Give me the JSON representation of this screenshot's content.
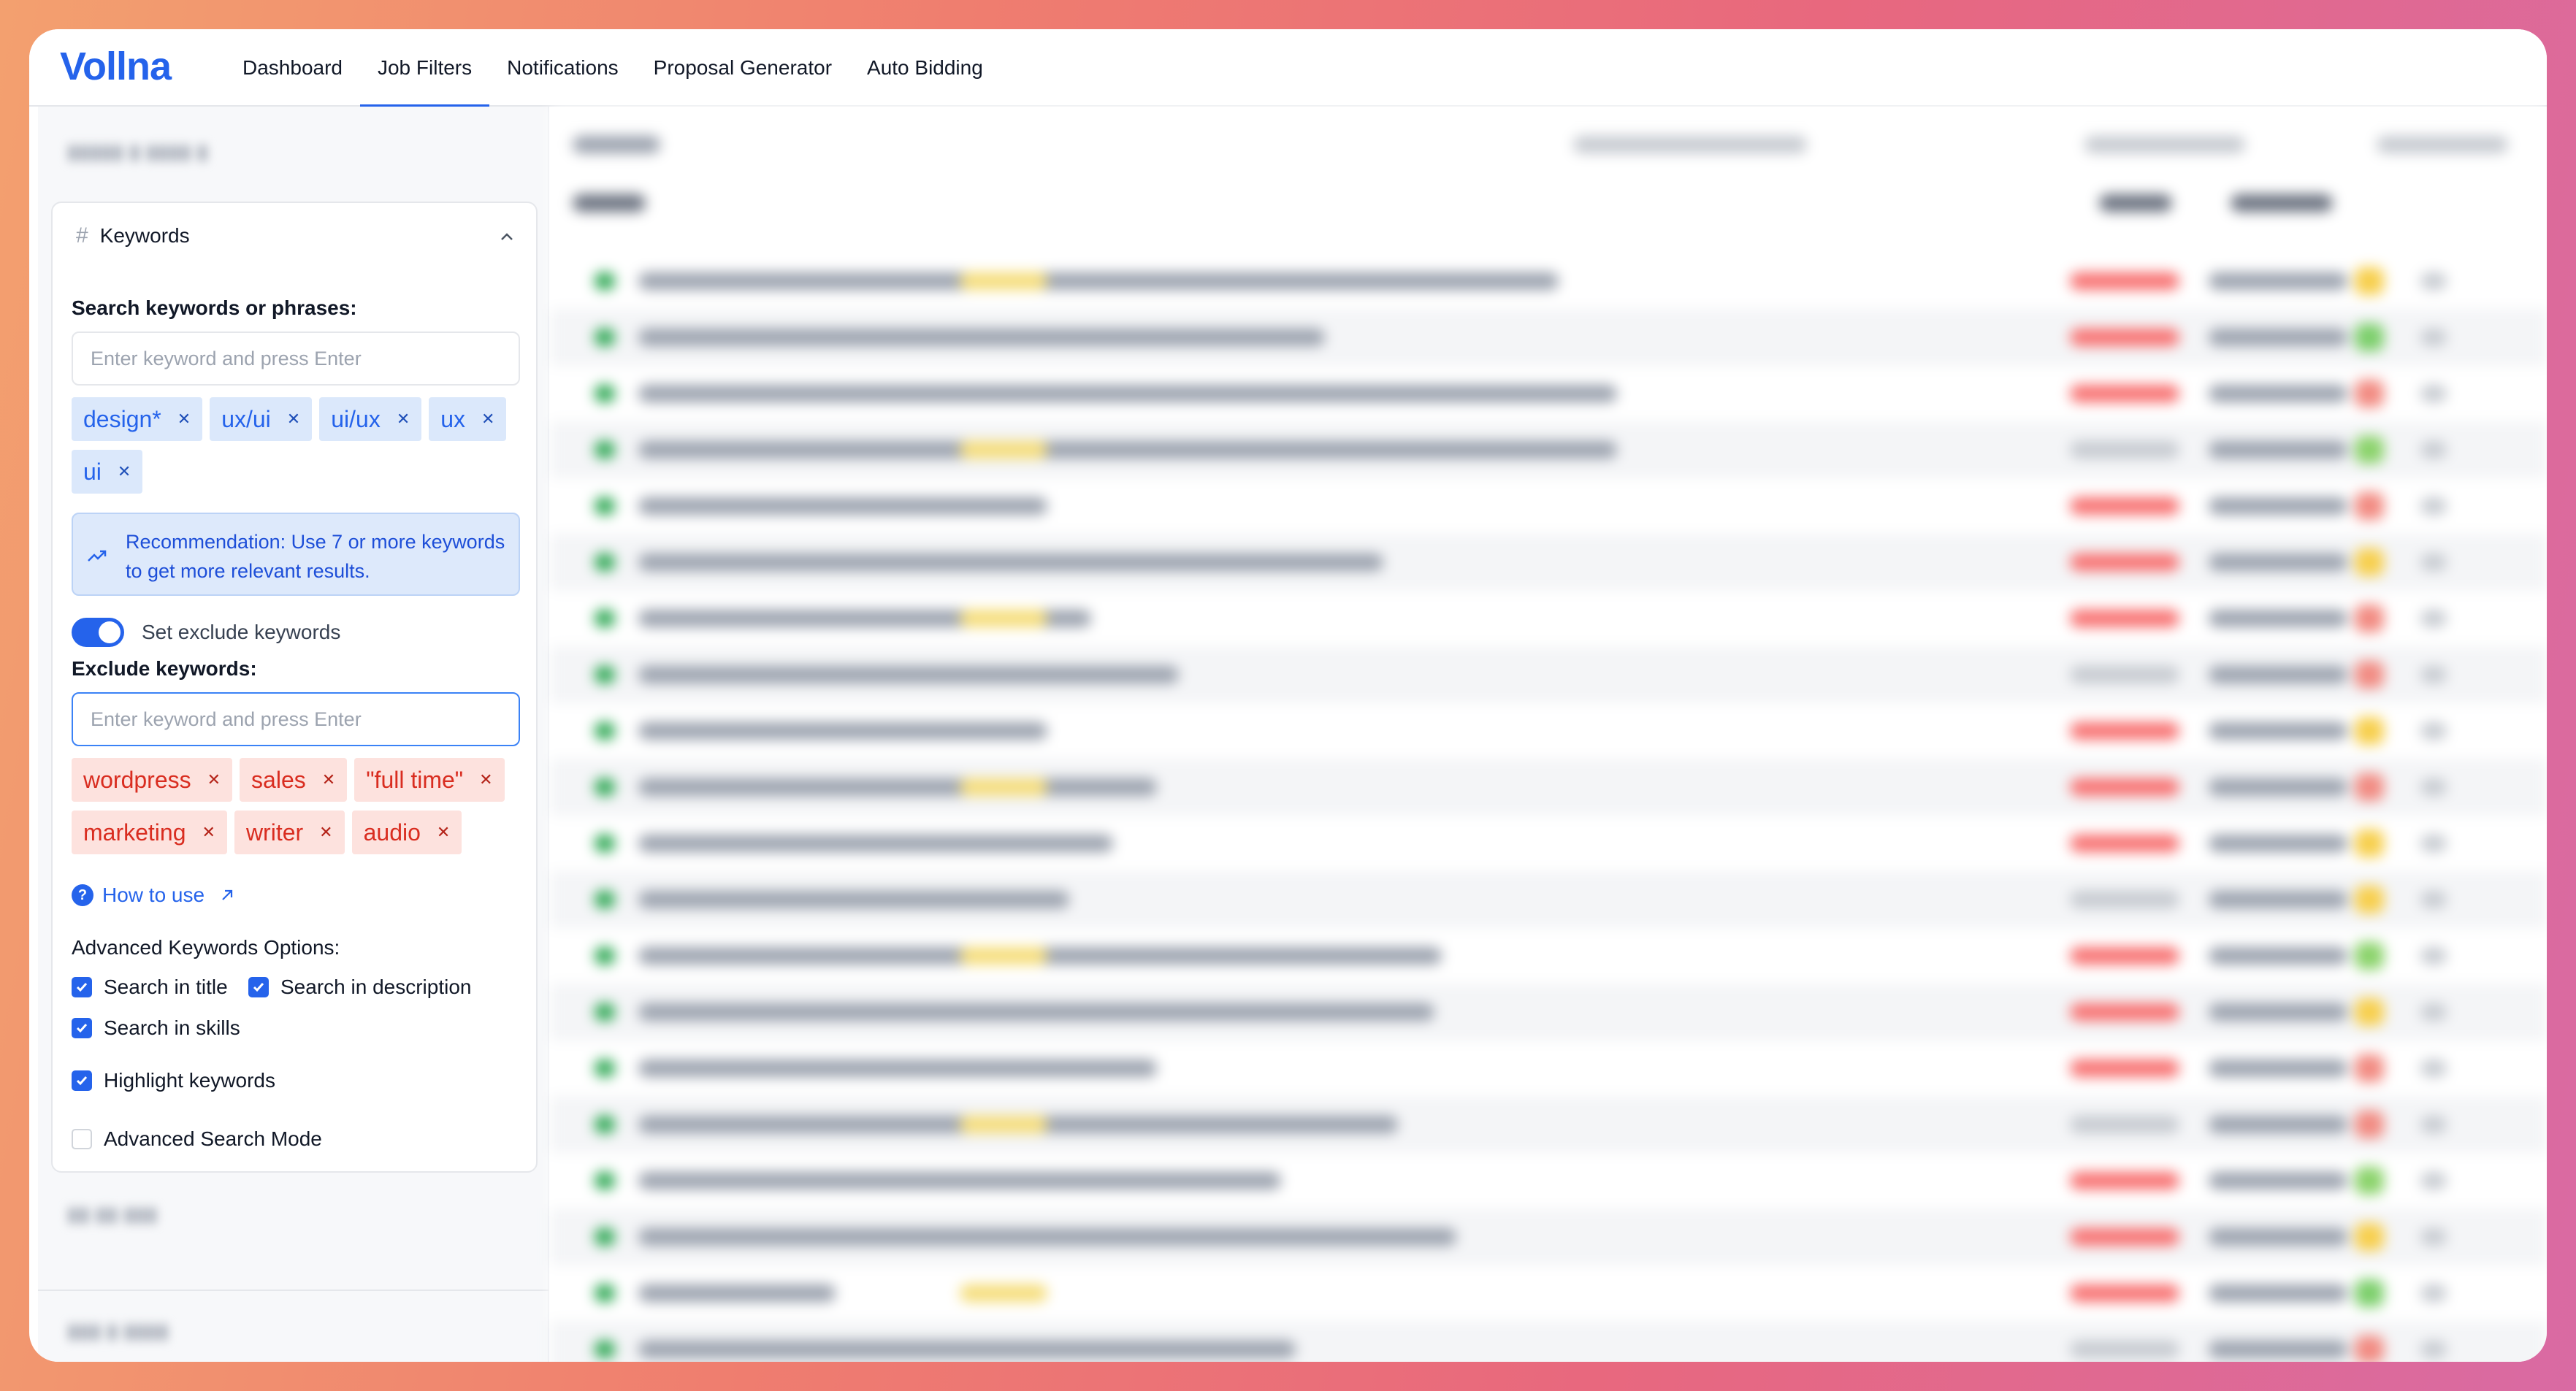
{
  "app": {
    "logo": "Vollna"
  },
  "nav": {
    "items": [
      "Dashboard",
      "Job Filters",
      "Notifications",
      "Proposal Generator",
      "Auto Bidding"
    ],
    "active": "Job Filters"
  },
  "keywords_panel": {
    "title": "Keywords",
    "search_label": "Search keywords or phrases:",
    "search_placeholder": "Enter keyword and press Enter",
    "include_tags": [
      "design*",
      "ux/ui",
      "ui/ux",
      "ux",
      "ui"
    ],
    "recommendation": "Recommendation: Use 7 or more keywords to get more relevant results.",
    "exclude_toggle_label": "Set exclude keywords",
    "exclude_label": "Exclude keywords:",
    "exclude_placeholder": "Enter keyword and press Enter",
    "exclude_tags": [
      "wordpress",
      "sales",
      "\"full time\"",
      "marketing",
      "writer",
      "audio"
    ],
    "how_to_use": "How to use",
    "advanced_label": "Advanced Keywords Options:",
    "options": {
      "search_in_title": "Search in title",
      "search_in_description": "Search in description",
      "search_in_skills": "Search in skills",
      "highlight_keywords": "Highlight keywords",
      "advanced_search_mode": "Advanced Search Mode"
    },
    "checked": {
      "search_in_title": true,
      "search_in_description": true,
      "search_in_skills": true,
      "highlight_keywords": true,
      "advanced_search_mode": false
    }
  },
  "colors": {
    "accent": "#2563eb",
    "include_tag_bg": "#dbe8fb",
    "exclude_tag_bg": "#fde2de",
    "exclude_tag_text": "#d92d20"
  }
}
